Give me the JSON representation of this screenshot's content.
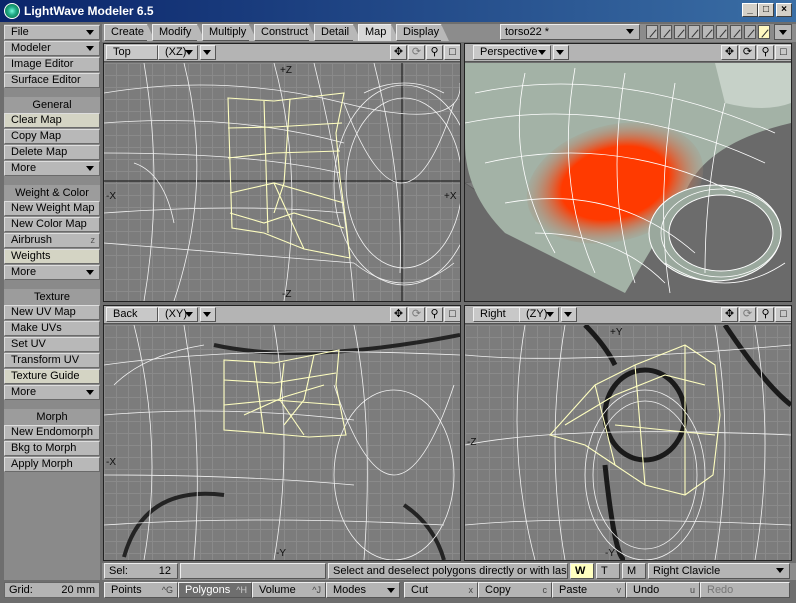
{
  "window": {
    "title": "LightWave Modeler 6.5",
    "min": "_",
    "max": "□",
    "close": "×"
  },
  "sidebar": {
    "file": "File",
    "modeler": "Modeler",
    "image_editor": "Image Editor",
    "surface_editor": "Surface Editor",
    "general": "General",
    "clear_map": "Clear Map",
    "copy_map": "Copy Map",
    "delete_map": "Delete Map",
    "more1": "More",
    "weight_color": "Weight & Color",
    "new_weight_map": "New Weight Map",
    "new_color_map": "New Color Map",
    "airbrush": "Airbrush",
    "airbrush_key": "z",
    "weights": "Weights",
    "more2": "More",
    "texture": "Texture",
    "new_uv_map": "New UV Map",
    "make_uvs": "Make UVs",
    "set_uv": "Set UV",
    "transform_uv": "Transform UV",
    "texture_guide": "Texture Guide",
    "more3": "More",
    "morph": "Morph",
    "new_endomorph": "New Endomorph",
    "bkg_to_morph": "Bkg to Morph",
    "apply_morph": "Apply Morph",
    "grid_label": "Grid:",
    "grid_value": "20 mm"
  },
  "tabs": [
    "Create",
    "Modify",
    "Multiply",
    "Construct",
    "Detail",
    "Map",
    "Display"
  ],
  "object": "torso22 *",
  "viewports": {
    "top": {
      "name": "Top",
      "axes": "(XZ)",
      "labels": {
        "n": "+Z",
        "w": "-X",
        "e": "+X",
        "s": "-Z"
      }
    },
    "persp": {
      "name": "Perspective"
    },
    "back": {
      "name": "Back",
      "axes": "(XY)",
      "labels": {
        "w": "-X",
        "s": "-Y"
      }
    },
    "right": {
      "name": "Right",
      "axes": "(ZY)",
      "labels": {
        "n": "+Y",
        "w": "-Z",
        "s": "-Y"
      }
    }
  },
  "status": {
    "sel_label": "Sel:",
    "sel_value": "12",
    "message": "Select and deselect polygons directly or with las...",
    "w": "W",
    "t": "T",
    "m": "M",
    "map": "Right Clavicle"
  },
  "bottom": {
    "points": "Points",
    "points_key": "^G",
    "polygons": "Polygons",
    "polygons_key": "^H",
    "volume": "Volume",
    "volume_key": "^J",
    "modes": "Modes",
    "cut": "Cut",
    "cut_key": "x",
    "copy": "Copy",
    "copy_key": "c",
    "paste": "Paste",
    "paste_key": "v",
    "undo": "Undo",
    "undo_key": "u",
    "redo": "Redo"
  },
  "colors": {
    "selection": "#ffffc0",
    "weight": "#ff3a00",
    "wire": "#ffffff",
    "bg": "#7c7c7c"
  }
}
